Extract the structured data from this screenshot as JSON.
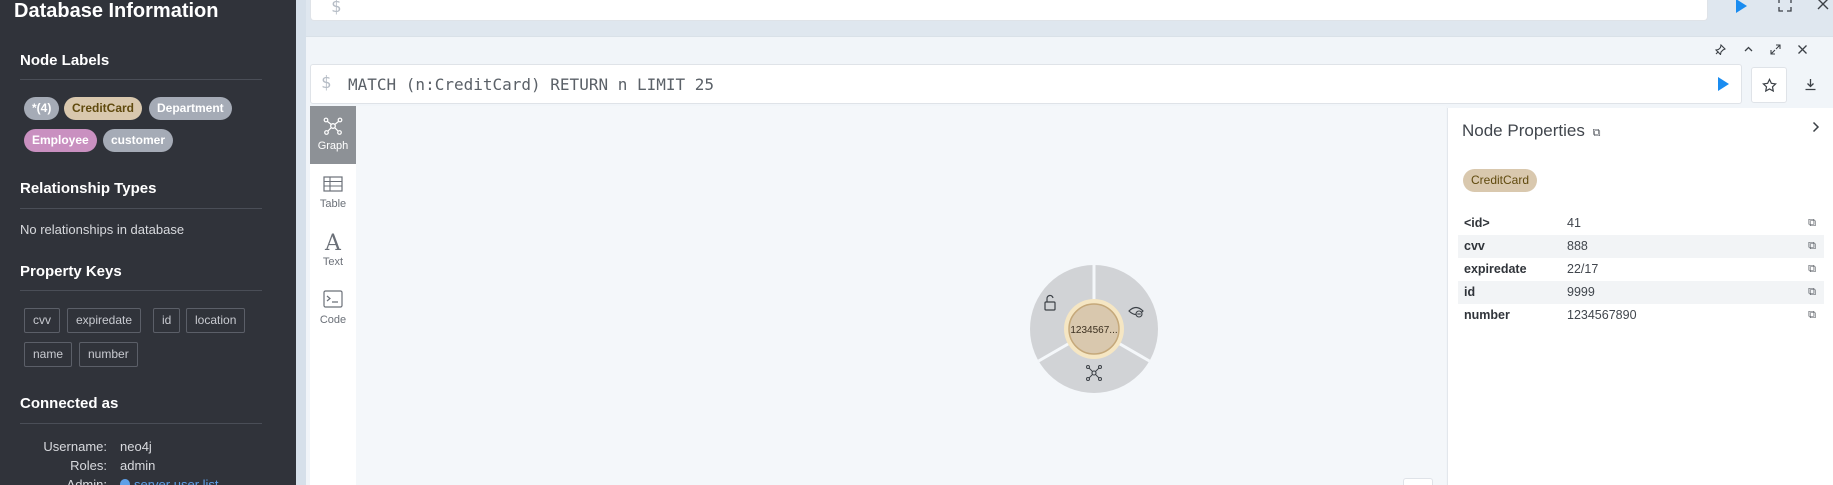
{
  "sidebar": {
    "title": "Database Information",
    "node_labels": {
      "heading": "Node Labels",
      "items": [
        {
          "label": "*(4)",
          "color": "#a5abb6",
          "text": "#ffffff"
        },
        {
          "label": "CreditCard",
          "color": "#d9c8ae",
          "text": "#604a0e"
        },
        {
          "label": "Department",
          "color": "#a5abb6",
          "text": "#ffffff"
        },
        {
          "label": "Employee",
          "color": "#c990c0",
          "text": "#ffffff"
        },
        {
          "label": "customer",
          "color": "#a5abb6",
          "text": "#ffffff"
        }
      ]
    },
    "relationship_types": {
      "heading": "Relationship Types",
      "empty_text": "No relationships in database"
    },
    "property_keys": {
      "heading": "Property Keys",
      "items": [
        "cvv",
        "expiredate",
        "id",
        "location",
        "name",
        "number"
      ]
    },
    "connected_as": {
      "heading": "Connected as",
      "username_label": "Username:",
      "username": "neo4j",
      "roles_label": "Roles:",
      "roles": "admin",
      "admin_label": "Admin:",
      "admin_link": "server user list"
    }
  },
  "top_frame": {
    "prompt": "$"
  },
  "frame": {
    "prompt": "$",
    "query": "MATCH (n:CreditCard) RETURN n LIMIT 25",
    "views": [
      {
        "label": "Graph",
        "icon": "graph-icon"
      },
      {
        "label": "Table",
        "icon": "table-icon"
      },
      {
        "label": "Text",
        "icon": "text-icon"
      },
      {
        "label": "Code",
        "icon": "code-icon"
      }
    ],
    "node": {
      "caption": "1234567...",
      "fill": "#d9c8ae",
      "ring": "#f5e6c3"
    },
    "properties": {
      "title": "Node Properties",
      "label_badge": "CreditCard",
      "rows": [
        {
          "key": "<id>",
          "value": "41"
        },
        {
          "key": "cvv",
          "value": "888"
        },
        {
          "key": "expiredate",
          "value": "22/17"
        },
        {
          "key": "id",
          "value": "9999"
        },
        {
          "key": "number",
          "value": "1234567890"
        }
      ]
    }
  }
}
